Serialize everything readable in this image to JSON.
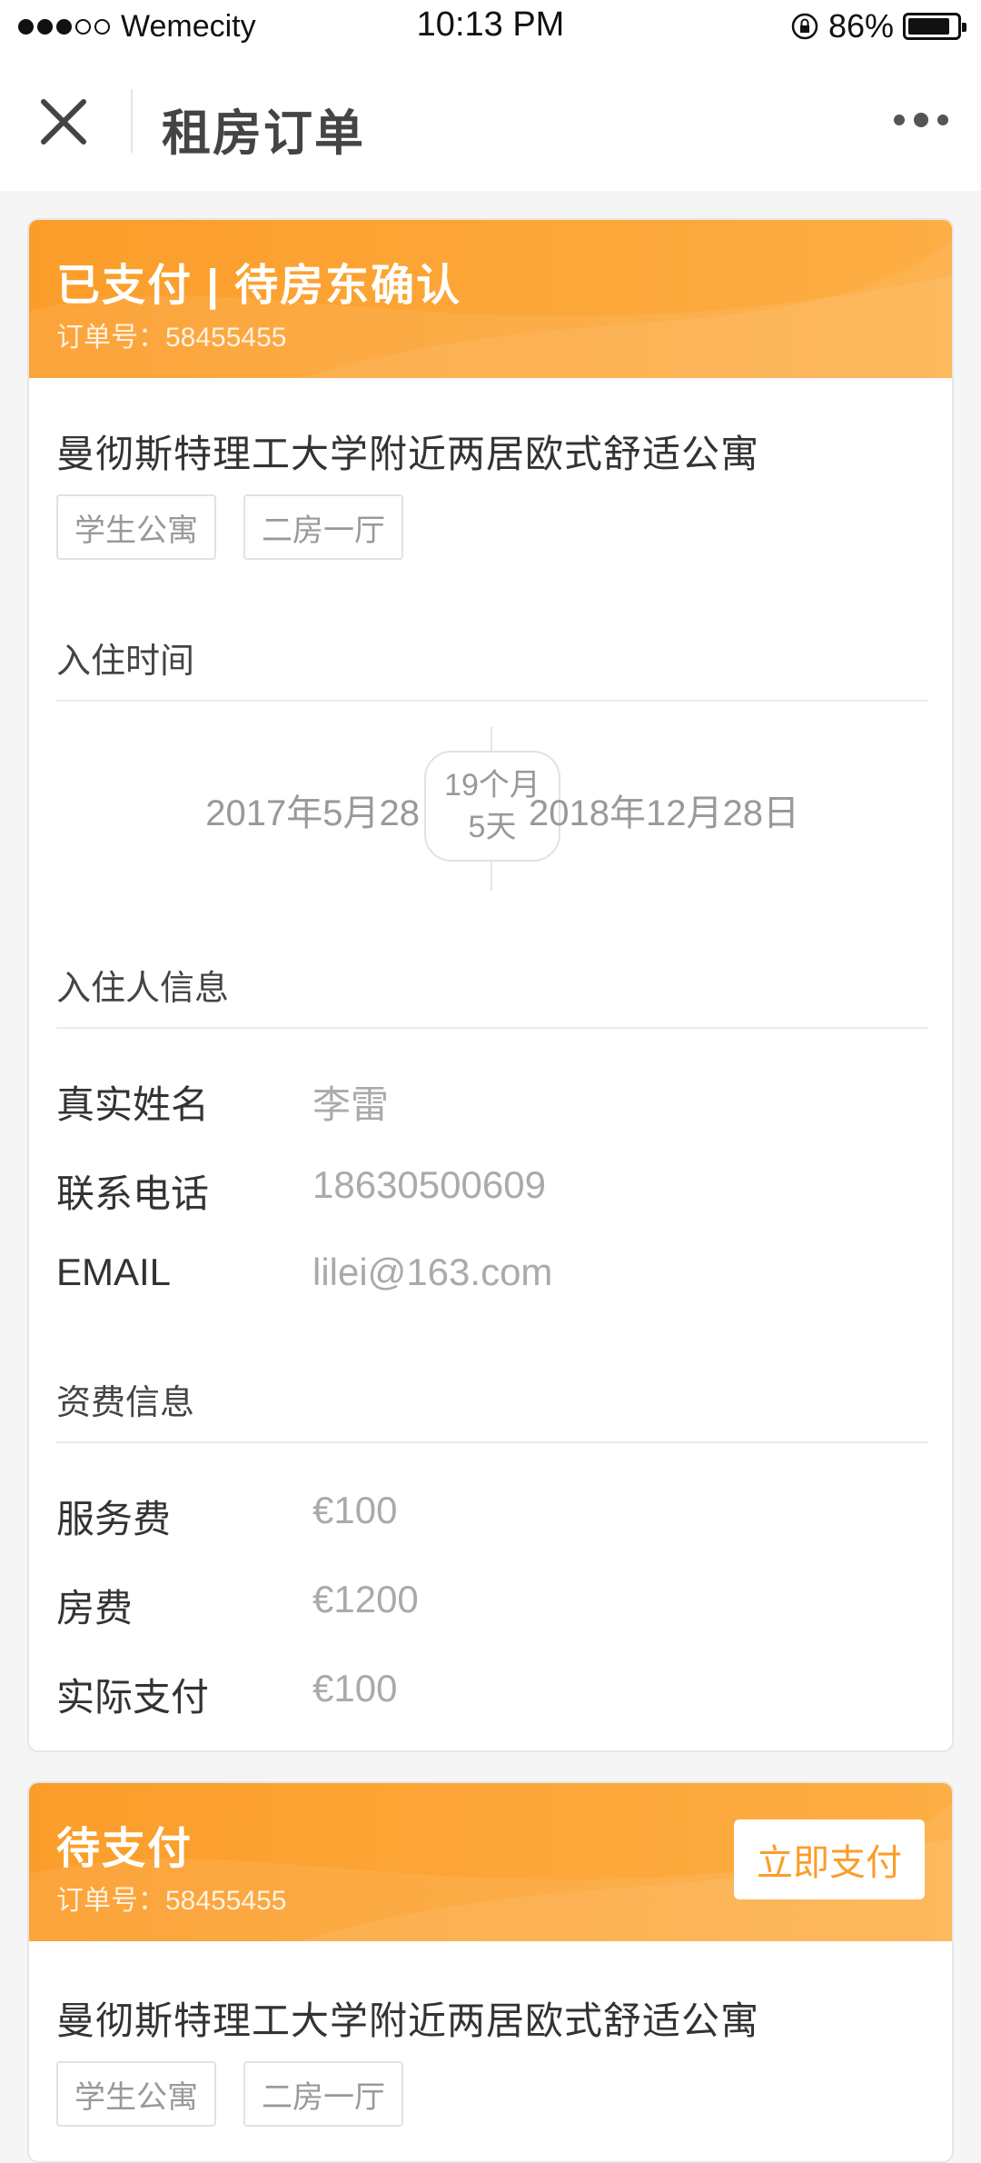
{
  "status_bar": {
    "carrier": "Wemecity",
    "time": "10:13 PM",
    "battery_percent": "86%",
    "battery_level": 0.86
  },
  "nav": {
    "title": "租房订单"
  },
  "orders": [
    {
      "status": "已支付 | 待房东确认",
      "order_no": "订单号：58455455",
      "property_title": "曼彻斯特理工大学附近两居欧式舒适公寓",
      "tags": [
        "学生公寓",
        "二房一厅"
      ],
      "checkin_section": "入住时间",
      "start_date": "2017年5月28日",
      "end_date": "2018年12月28日",
      "duration_line1": "19个月",
      "duration_line2": "5天",
      "guest_section": "入住人信息",
      "guest": [
        {
          "label": "真实姓名",
          "value": "李雷"
        },
        {
          "label": "联系电话",
          "value": "18630500609"
        },
        {
          "label": "EMAIL",
          "value": "lilei@163.com"
        }
      ],
      "fee_section": "资费信息",
      "fees": [
        {
          "label": "服务费",
          "value": "€100"
        },
        {
          "label": "房费",
          "value": "€1200"
        },
        {
          "label": "实际支付",
          "value": "€100"
        }
      ]
    },
    {
      "status": "待支付",
      "order_no": "订单号：58455455",
      "pay_button": "立即支付",
      "property_title": "曼彻斯特理工大学附近两居欧式舒适公寓",
      "tags": [
        "学生公寓",
        "二房一厅"
      ]
    }
  ],
  "colors": {
    "accent": "#fb9d2a",
    "text_primary": "#333333",
    "text_muted": "#999999"
  }
}
